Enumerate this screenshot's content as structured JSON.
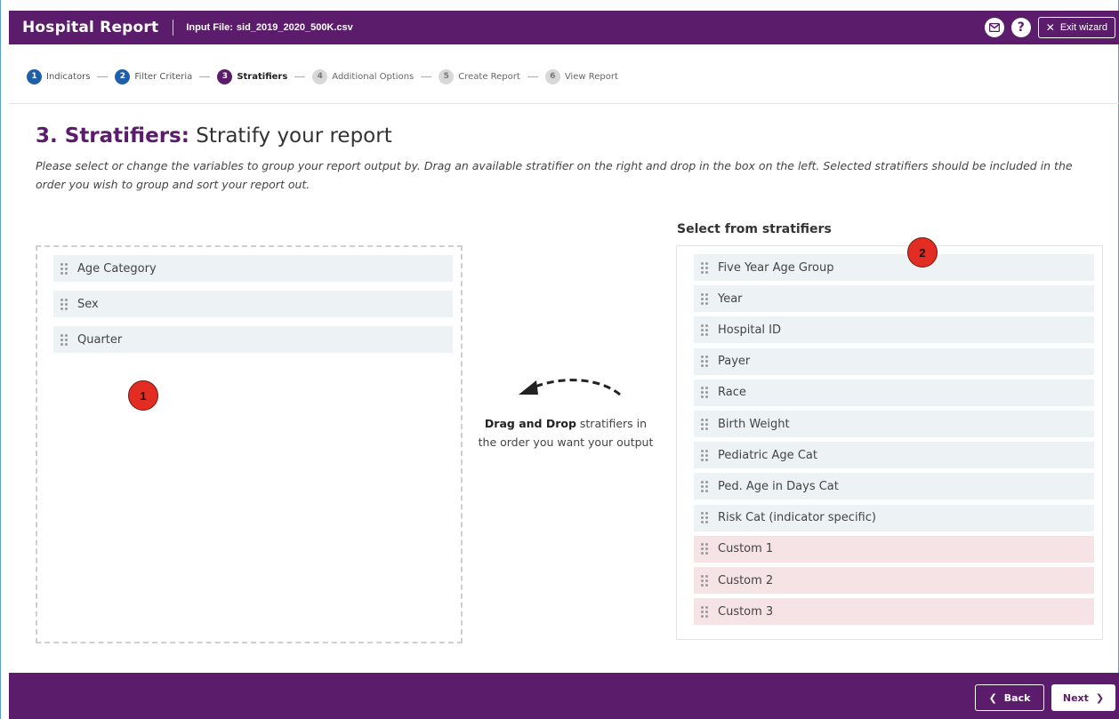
{
  "header": {
    "title": "Hospital Report",
    "input_label": "Input File:",
    "input_value": "sid_2019_2020_500K.csv",
    "exit_label": "Exit wizard"
  },
  "stepper": [
    {
      "num": "1",
      "label": "Indicators",
      "state": "done"
    },
    {
      "num": "2",
      "label": "Filter Criteria",
      "state": "done"
    },
    {
      "num": "3",
      "label": "Stratifiers",
      "state": "active"
    },
    {
      "num": "4",
      "label": "Additional Options",
      "state": "todo"
    },
    {
      "num": "5",
      "label": "Create Report",
      "state": "todo"
    },
    {
      "num": "6",
      "label": "View Report",
      "state": "todo"
    }
  ],
  "page": {
    "title_strong": "3. Stratifiers:",
    "title_rest": "Stratify your report",
    "description": "Please select or change the variables to group your report output by. Drag an available stratifier on the right and drop in the box on the left. Selected stratifiers should be included in the order you wish to group and sort your report out."
  },
  "selected": [
    "Age Category",
    "Sex",
    "Quarter"
  ],
  "instruction": {
    "bold": "Drag and Drop",
    "rest": " stratifiers in the order you want your output"
  },
  "available": {
    "title": "Select from stratifiers",
    "items": [
      {
        "label": "Five Year Age Group",
        "custom": false
      },
      {
        "label": "Year",
        "custom": false
      },
      {
        "label": "Hospital ID",
        "custom": false
      },
      {
        "label": "Payer",
        "custom": false
      },
      {
        "label": "Race",
        "custom": false
      },
      {
        "label": "Birth Weight",
        "custom": false
      },
      {
        "label": "Pediatric Age Cat",
        "custom": false
      },
      {
        "label": "Ped. Age in Days Cat",
        "custom": false
      },
      {
        "label": "Risk Cat (indicator specific)",
        "custom": false
      },
      {
        "label": "Custom 1",
        "custom": true
      },
      {
        "label": "Custom 2",
        "custom": true
      },
      {
        "label": "Custom 3",
        "custom": true
      }
    ]
  },
  "annotations": [
    "1",
    "2"
  ],
  "footer": {
    "back_label": "Back",
    "next_label": "Next"
  },
  "colors": {
    "brand": "#5b1c6b",
    "step_done": "#1f5fa9",
    "item_bg": "#edf2f4",
    "custom_bg": "#f6e3e5",
    "badge": "#e32d22"
  }
}
